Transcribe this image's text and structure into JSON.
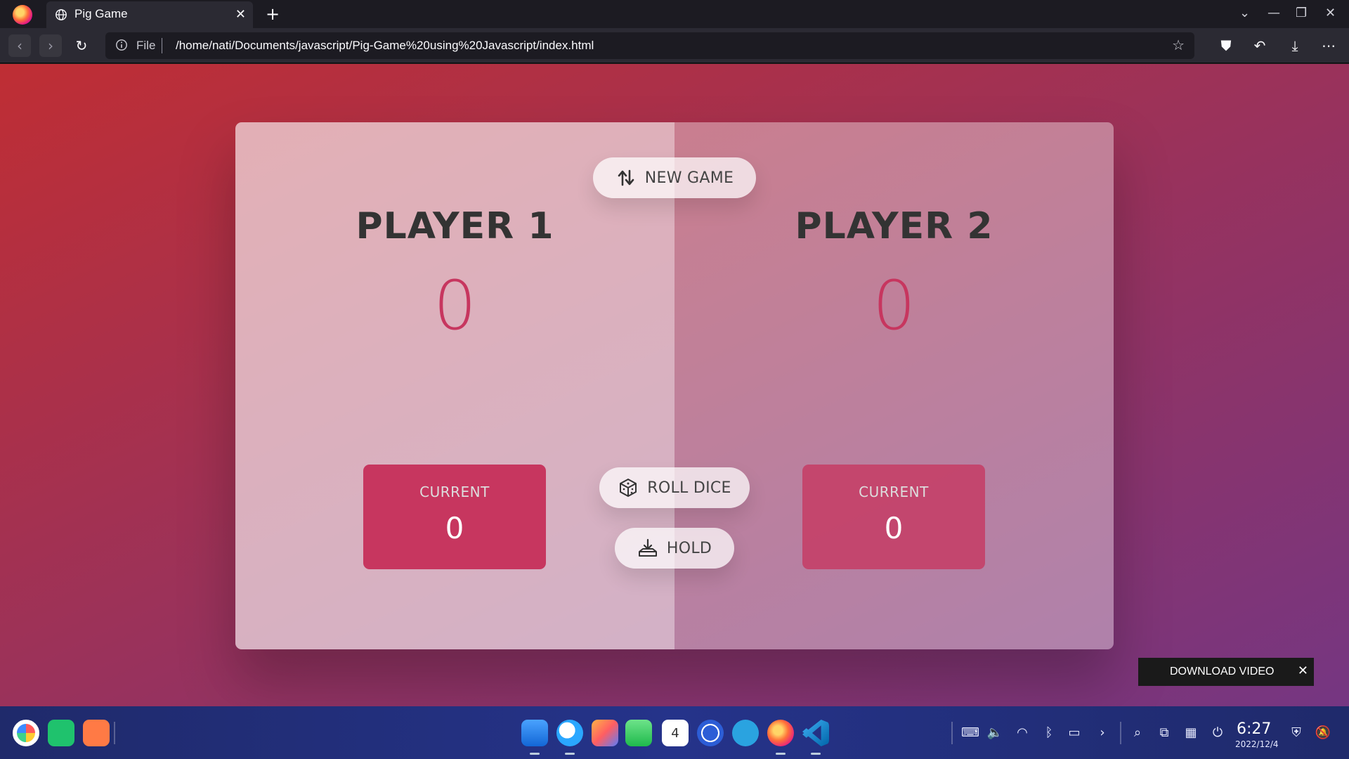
{
  "browser": {
    "tab_title": "Pig Game",
    "url_protocol": "File",
    "url": "/home/nati/Documents/javascript/Pig-Game%20using%20Javascript/index.html"
  },
  "game": {
    "new_game_label": "NEW GAME",
    "roll_dice_label": "ROLL DICE",
    "hold_label": "HOLD",
    "player1": {
      "name": "PLAYER 1",
      "score": "0",
      "current_label": "CURRENT",
      "current_score": "0",
      "active": true
    },
    "player2": {
      "name": "PLAYER 2",
      "score": "0",
      "current_label": "CURRENT",
      "current_score": "0",
      "active": false
    },
    "colors": {
      "accent": "#c7365f",
      "bg_from": "#bf2e34",
      "bg_to": "#753682"
    }
  },
  "overlay": {
    "download_video_label": "DOWNLOAD VIDEO"
  },
  "taskbar": {
    "time": "6:27",
    "date": "2022/12/4",
    "calendar_day": "4"
  }
}
